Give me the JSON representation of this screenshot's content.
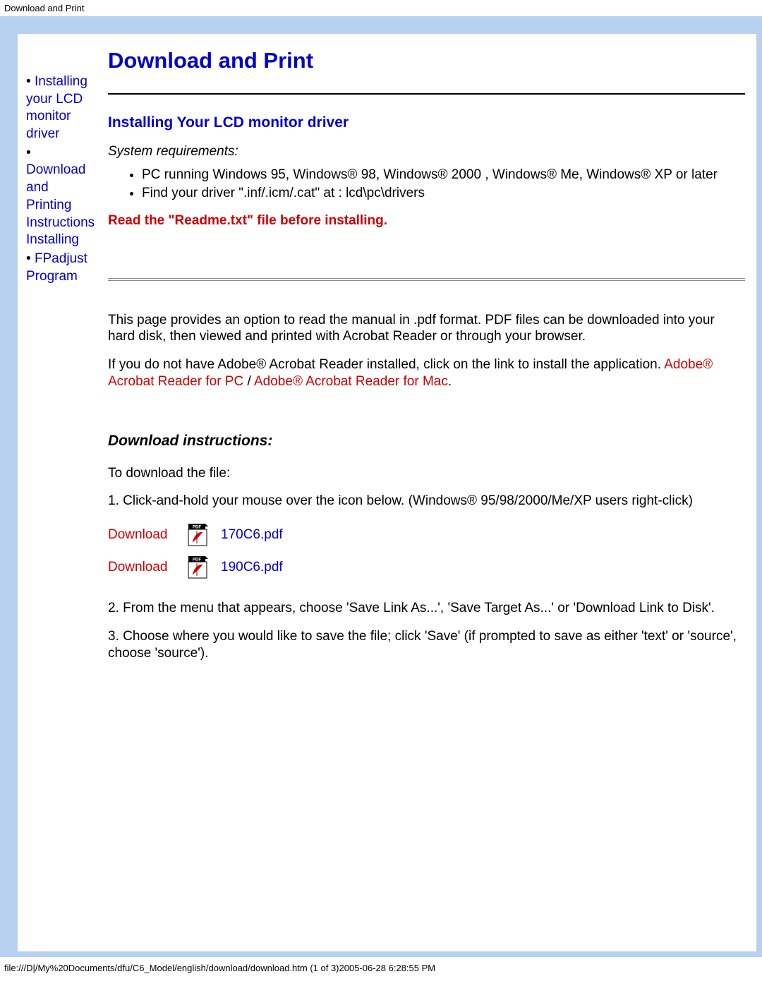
{
  "header_path": "Download and Print",
  "sidebar": {
    "items": [
      {
        "label": "Installing your LCD monitor driver"
      },
      {
        "label": "Download and Printing Instructions Installing"
      },
      {
        "label": "FPadjust Program"
      }
    ]
  },
  "page_title": "Download and Print",
  "section1": {
    "title": "Installing Your LCD monitor driver",
    "sysreq_label": "System requirements:",
    "req1": "PC running Windows 95, Windows® 98, Windows® 2000 , Windows® Me, Windows® XP or later",
    "req2": "Find your driver \".inf/.icm/.cat\" at : lcd\\pc\\drivers",
    "readme_note": "Read the \"Readme.txt\" file before installing."
  },
  "section2": {
    "para1": "This page provides an option to read the manual in .pdf format. PDF files can be downloaded into your hard disk, then viewed and printed with Acrobat Reader or through your browser.",
    "para2_prefix": "If you do not have Adobe® Acrobat Reader installed, click on the link to install the application. ",
    "acrobat_pc": "Adobe® Acrobat Reader for PC",
    "separator": " / ",
    "acrobat_mac": "Adobe® Acrobat Reader for Mac",
    "period": "."
  },
  "download_instructions": {
    "heading": "Download instructions:",
    "intro": "To download the file:",
    "step1": "1. Click-and-hold your mouse over the icon below. (Windows® 95/98/2000/Me/XP users right-click)",
    "dl_label": "Download",
    "file1": "170C6.pdf",
    "file2": "190C6.pdf",
    "step2": "2. From the menu that appears, choose 'Save Link As...', 'Save Target As...' or 'Download Link to Disk'.",
    "step3": "3. Choose where you would like to save the file; click 'Save' (if prompted to save as either 'text' or 'source', choose 'source')."
  },
  "footer_path": "file:///D|/My%20Documents/dfu/C6_Model/english/download/download.htm (1 of 3)2005-06-28 6:28:55 PM"
}
